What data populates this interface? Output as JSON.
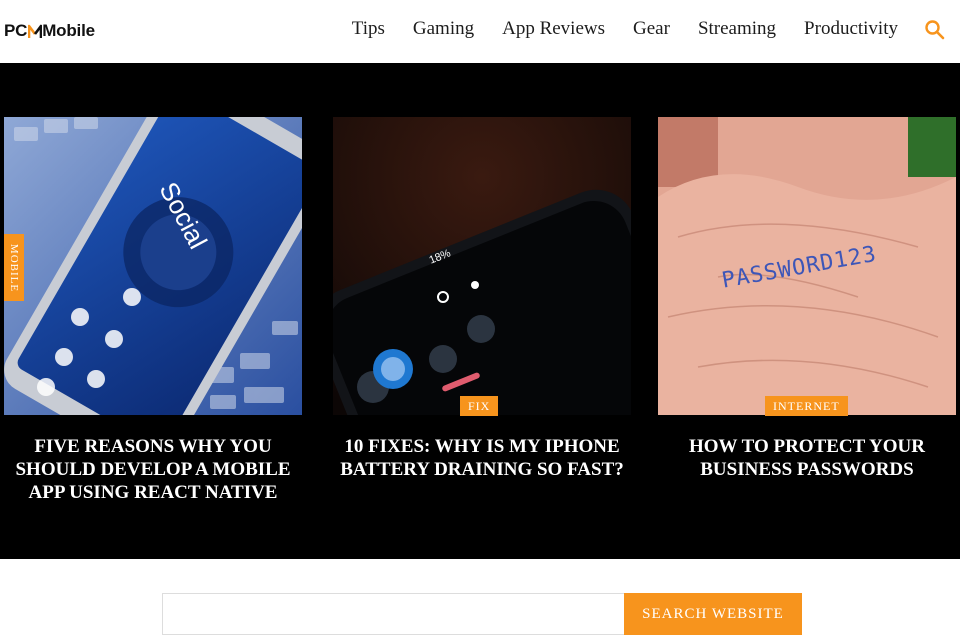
{
  "brand": {
    "logo_text_left": "PC",
    "logo_text_right": "Mobile",
    "accent_color": "#f7941d"
  },
  "nav": {
    "items": [
      "Tips",
      "Gaming",
      "App Reviews",
      "Gear",
      "Streaming",
      "Productivity"
    ],
    "search_icon": "search-icon"
  },
  "featured": {
    "cards": [
      {
        "title": "FIVE REASONS WHY YOU SHOULD DEVELOP A MOBILE APP USING REACT NATIVE",
        "tag": "MOBILE",
        "image_text": "Social"
      },
      {
        "title": "10 FIXES: WHY IS MY IPHONE BATTERY DRAINING SO FAST?",
        "tag": "FIX",
        "image_text": "18%"
      },
      {
        "title": "HOW TO PROTECT YOUR BUSINESS PASSWORDS",
        "tag": "INTERNET",
        "image_text": "PASSWORD123"
      }
    ]
  },
  "search": {
    "placeholder": "",
    "button_label": "SEARCH WEBSITE"
  }
}
